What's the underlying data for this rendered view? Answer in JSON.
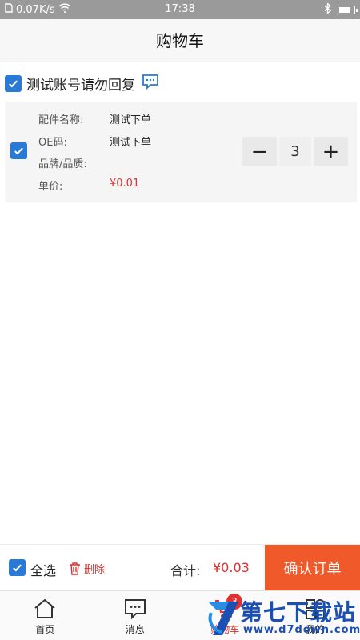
{
  "status_bar": {
    "network_speed": "0.07K/s",
    "time": "17:38",
    "battery_level": 0.85
  },
  "header": {
    "title": "购物车"
  },
  "shop": {
    "name": "测试账号请勿回复",
    "checked": true
  },
  "item": {
    "checked": true,
    "fields": [
      {
        "label": "配件名称:",
        "value": "测试下单"
      },
      {
        "label": "OE码:",
        "value": "测试下单"
      },
      {
        "label": "品牌/品质:",
        "value": ""
      },
      {
        "label": "单价:",
        "value": "¥0.01"
      }
    ],
    "quantity": "3",
    "minus": "−",
    "plus": "+"
  },
  "footer": {
    "select_all": "全选",
    "delete": "删除",
    "total_label": "合计:",
    "total_value": "¥0.03",
    "confirm": "确认订单"
  },
  "tabs": [
    {
      "label": "首页",
      "icon": "home-icon"
    },
    {
      "label": "消息",
      "icon": "message-icon"
    },
    {
      "label": "购物车",
      "icon": "cart-icon",
      "badge": "3",
      "active": true
    },
    {
      "label": "我的",
      "icon": "user-icon"
    }
  ],
  "watermark": {
    "title": "第七下载站",
    "url": "www.d7down.com"
  },
  "colors": {
    "accent_blue": "#2979d6",
    "price_red": "#e0302f",
    "confirm_orange": "#f05a2a"
  }
}
